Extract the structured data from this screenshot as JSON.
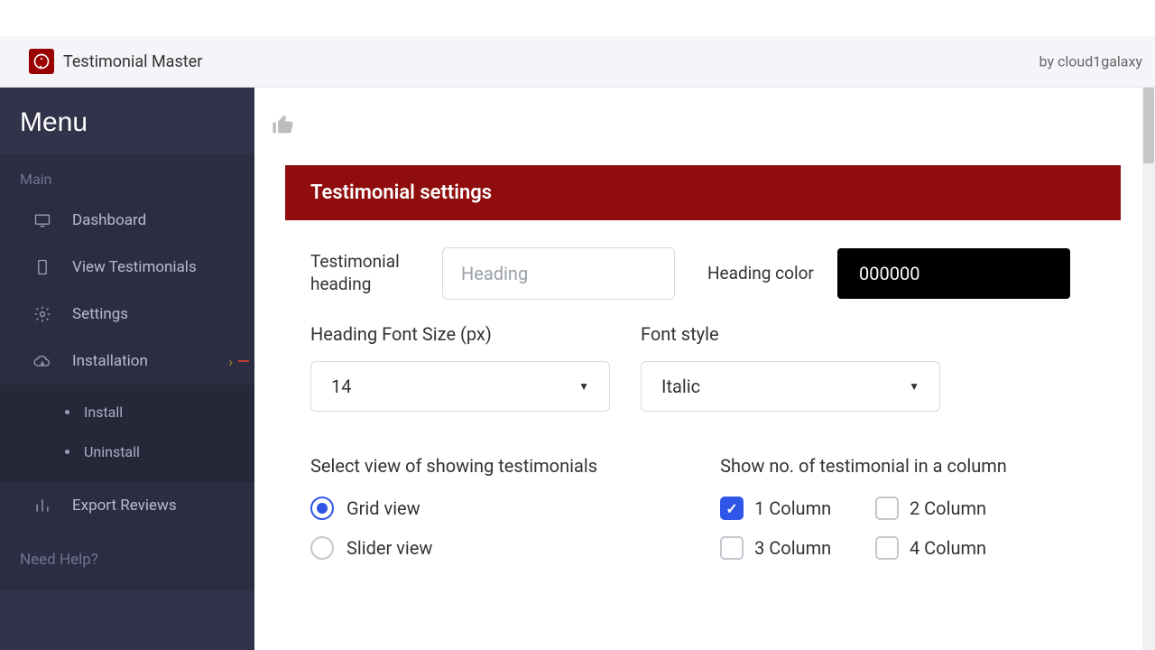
{
  "header": {
    "app_title": "Testimonial Master",
    "byline": "by cloud1galaxy"
  },
  "sidebar": {
    "menu_label": "Menu",
    "section_label": "Main",
    "items": [
      {
        "name": "dashboard",
        "label": "Dashboard",
        "icon": "monitor-icon"
      },
      {
        "name": "view-testimonials",
        "label": "View Testimonials",
        "icon": "phone-icon"
      },
      {
        "name": "settings",
        "label": "Settings",
        "icon": "gear-icon"
      },
      {
        "name": "installation",
        "label": "Installation",
        "icon": "cloud-download-icon",
        "expanded": true
      }
    ],
    "sub_items": [
      {
        "name": "install",
        "label": "Install"
      },
      {
        "name": "uninstall",
        "label": "Uninstall"
      }
    ],
    "export_label": "Export Reviews",
    "need_help": "Need Help?"
  },
  "card": {
    "title": "Testimonial settings",
    "heading_label": "Testimonial heading",
    "heading_placeholder": "Heading",
    "heading_value": "",
    "heading_color_label": "Heading color",
    "heading_color_value": "000000",
    "font_size_label": "Heading Font Size (px)",
    "font_size_value": "14",
    "font_style_label": "Font style",
    "font_style_value": "Italic",
    "view_group_label": "Select view of showing testimonials",
    "view_options": [
      {
        "name": "grid-view",
        "label": "Grid view",
        "checked": true
      },
      {
        "name": "slider-view",
        "label": "Slider view",
        "checked": false
      }
    ],
    "columns_group_label": "Show no. of testimonial in a column",
    "column_options": [
      {
        "name": "col-1",
        "label": "1 Column",
        "checked": true
      },
      {
        "name": "col-2",
        "label": "2 Column",
        "checked": false
      },
      {
        "name": "col-3",
        "label": "3 Column",
        "checked": false
      },
      {
        "name": "col-4",
        "label": "4 Column",
        "checked": false
      }
    ]
  }
}
